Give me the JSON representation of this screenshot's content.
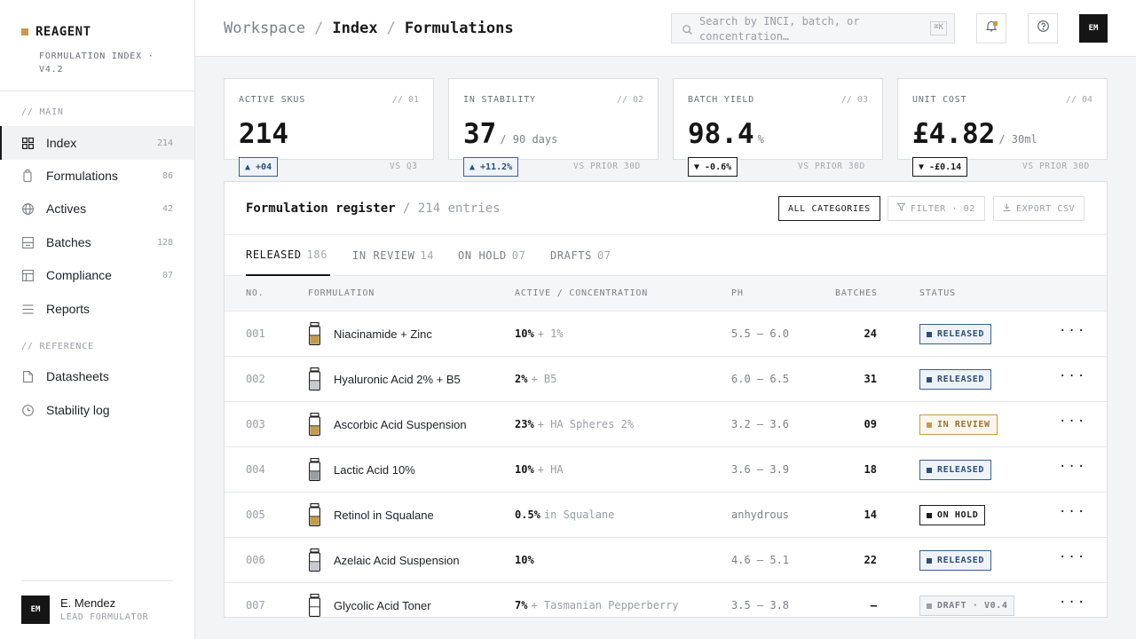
{
  "brand": {
    "name": "REAGENT",
    "subtitle": "FORMULATION INDEX · V4.2",
    "accent": "#c49a4c"
  },
  "sidebar": {
    "main_section": "// MAIN",
    "reference_section": "// REFERENCE",
    "items": [
      {
        "label": "Index",
        "count": "214",
        "icon": "grid-icon"
      },
      {
        "label": "Formulations",
        "count": "86",
        "icon": "bottle-icon"
      },
      {
        "label": "Actives",
        "count": "42",
        "icon": "globe-icon"
      },
      {
        "label": "Batches",
        "count": "128",
        "icon": "tray-icon"
      },
      {
        "label": "Compliance",
        "count": "07",
        "icon": "table-icon"
      },
      {
        "label": "Reports",
        "count": "",
        "icon": "lines-icon"
      }
    ],
    "reference_items": [
      {
        "label": "Datasheets",
        "icon": "document-icon"
      },
      {
        "label": "Stability log",
        "icon": "clock-icon"
      }
    ],
    "user": {
      "initials": "EM",
      "name": "E. Mendez",
      "role": "LEAD FORMULATOR"
    }
  },
  "header": {
    "breadcrumb": [
      "Workspace",
      "Index",
      "Formulations"
    ],
    "separator": "/",
    "search_placeholder": "Search by INCI, batch, or concentration…",
    "search_shortcut": "⌘K",
    "avatar_initials": "EM"
  },
  "kpis": [
    {
      "label": "ACTIVE SKUS",
      "index": "// 01",
      "value": "214",
      "unit": "",
      "delta": "▲ +04",
      "delta_dir": "up",
      "compare": "VS Q3"
    },
    {
      "label": "IN STABILITY",
      "index": "// 02",
      "value": "37",
      "unit": "/ 90 days",
      "delta": "▲ +11.2%",
      "delta_dir": "up",
      "compare": "VS PRIOR 30D"
    },
    {
      "label": "BATCH YIELD",
      "index": "// 03",
      "value": "98.4",
      "unit": "%",
      "delta": "▼ -0.6%",
      "delta_dir": "down",
      "compare": "VS PRIOR 30D"
    },
    {
      "label": "UNIT COST",
      "index": "// 04",
      "value": "£4.82",
      "unit": "/ 30ml",
      "delta": "▼ -£0.14",
      "delta_dir": "down",
      "compare": "VS PRIOR 30D"
    }
  ],
  "register": {
    "title": "Formulation register",
    "subtitle": "/ 214 entries",
    "categories_label": "ALL CATEGORIES",
    "filter_label": "FILTER · 02",
    "export_label": "EXPORT CSV",
    "tabs": [
      {
        "label": "RELEASED",
        "count": "186"
      },
      {
        "label": "IN REVIEW",
        "count": "14"
      },
      {
        "label": "ON HOLD",
        "count": "07"
      },
      {
        "label": "DRAFTS",
        "count": "07"
      }
    ],
    "columns": [
      "NO.",
      "FORMULATION",
      "ACTIVE / CONCENTRATION",
      "PH",
      "BATCHES",
      "STATUS"
    ],
    "rows": [
      {
        "no": "001",
        "name": "Niacinamide + Zinc",
        "conc": "10%",
        "conc_extra": "+ 1%",
        "ph": "5.5 – 6.0",
        "batches": "24",
        "status": "RELEASED",
        "status_key": "released",
        "fill": "#c49a4c"
      },
      {
        "no": "002",
        "name": "Hyaluronic Acid 2% + B5",
        "conc": "2%",
        "conc_extra": "+ B5",
        "ph": "6.0 – 6.5",
        "batches": "31",
        "status": "RELEASED",
        "status_key": "released",
        "fill": "#c8cacf"
      },
      {
        "no": "003",
        "name": "Ascorbic Acid Suspension",
        "conc": "23%",
        "conc_extra": "+ HA Spheres 2%",
        "ph": "3.2 – 3.6",
        "batches": "09",
        "status": "IN REVIEW",
        "status_key": "review",
        "fill": "#c49a4c"
      },
      {
        "no": "004",
        "name": "Lactic Acid 10%",
        "conc": "10%",
        "conc_extra": "+ HA",
        "ph": "3.6 – 3.9",
        "batches": "18",
        "status": "RELEASED",
        "status_key": "released",
        "fill": "#9a9da3"
      },
      {
        "no": "005",
        "name": "Retinol in Squalane",
        "conc": "0.5%",
        "conc_extra": "in Squalane",
        "ph": "anhydrous",
        "batches": "14",
        "status": "ON HOLD",
        "status_key": "hold",
        "fill": "#c49a4c"
      },
      {
        "no": "006",
        "name": "Azelaic Acid Suspension",
        "conc": "10%",
        "conc_extra": "",
        "ph": "4.6 – 5.1",
        "batches": "22",
        "status": "RELEASED",
        "status_key": "released",
        "fill": "#c8cacf"
      },
      {
        "no": "007",
        "name": "Glycolic Acid Toner",
        "conc": "7%",
        "conc_extra": "+ Tasmanian Pepperberry",
        "ph": "3.5 – 3.8",
        "batches": "—",
        "status": "DRAFT · V0.4",
        "status_key": "draft",
        "fill": "#ffffff"
      }
    ],
    "more_label": "···"
  }
}
